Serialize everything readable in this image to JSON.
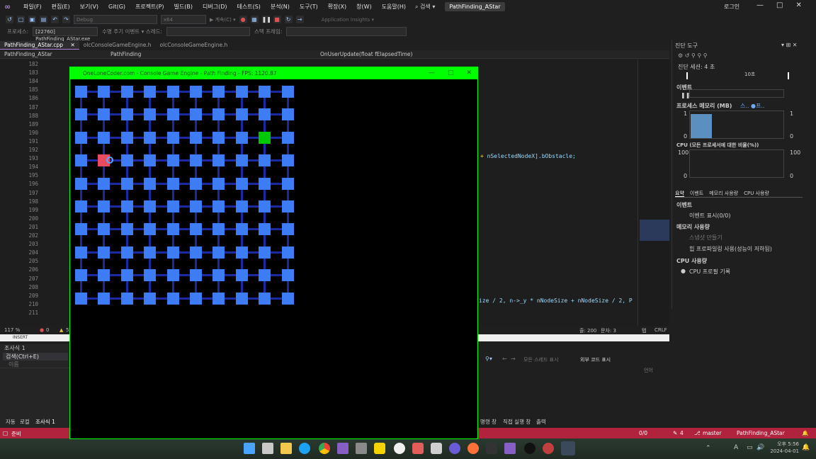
{
  "menubar": {
    "logo": "∞",
    "items": [
      "파일(F)",
      "편집(E)",
      "보기(V)",
      "Git(G)",
      "프로젝트(P)",
      "빌드(B)",
      "디버그(D)",
      "테스트(S)",
      "분석(N)",
      "도구(T)",
      "확장(X)",
      "창(W)",
      "도움말(H)"
    ],
    "search": "⌕ 검색 ▾",
    "solution_title": "PathFinding_AStar",
    "login": "로그인",
    "window_controls": [
      "—",
      "□",
      "✕"
    ]
  },
  "toolbar": {
    "config": "Debug",
    "platform": "x64",
    "continue_label": "▶ 계속(C) ▾",
    "insights": "Application Insights ▾",
    "process_label": "프로세스:",
    "process_value": "[22760] PathFinding_AStar.exe",
    "lifecycle": "수명 주기 이벤트 ▾ 스레드:",
    "stackframe": "스택 프레임:"
  },
  "tabs": [
    {
      "label": "PathFinding_AStar.cpp",
      "active": true,
      "suffix": "✕"
    },
    {
      "label": "olcConsoleGameEngine.h",
      "active": false
    },
    {
      "label": "olcConsoleGameEngine.h",
      "active": false
    }
  ],
  "navbar": {
    "project": "PathFinding_AStar",
    "scope": "PathFinding",
    "member": "OnUserUpdate(float fElapsedTime)"
  },
  "editor": {
    "line_numbers": [
      "182",
      "183",
      "184",
      "185",
      "186",
      "187",
      "188",
      "189",
      "190",
      "191",
      "192",
      "193",
      "194",
      "195",
      "196",
      "197",
      "198",
      "199",
      "200",
      "201",
      "202",
      "203",
      "204",
      "205",
      "206",
      "207",
      "208",
      "209",
      "210",
      "211"
    ],
    "code_line_1": "nSelectedNodeX].bObstacle;",
    "code_line_2": "ize / 2, n->_y * nNodeSize + nNodeSize / 2, P",
    "zoom": "117 %",
    "status_ln": "줄: 200",
    "status_col": "문자: 3",
    "status_space": "탭",
    "status_eol": "CRLF",
    "status_errors": "0",
    "status_warnings": "5"
  },
  "insert_mode": "INSERT",
  "watch": {
    "title": "조사식 1",
    "search": "검색(Ctrl+E)",
    "col_name": "이름",
    "col_lang": "언어"
  },
  "callstack_toolbar": {
    "show_threads": "모든 스레드 표시",
    "external_code": "외부 코드 표시"
  },
  "bottom_tabs": [
    "자동",
    "로컬",
    "조사식 1"
  ],
  "bottom_tabs_right": [
    "호출 스택",
    "중단점",
    "예외 설정",
    "명령 창",
    "직접 실행 창",
    "출력"
  ],
  "statusbar": {
    "ready": "준비",
    "lines": "0/0",
    "pencil_count": "4",
    "branch": "master",
    "repo": "PathFinding_AStar"
  },
  "diagnostics": {
    "title": "진단 도구",
    "session": "진단 세션: 4 초",
    "time_tick": "10초",
    "events": "이벤트",
    "memory": "프로세스 메모리 (MB)",
    "memory_legend": "스.. ●프..",
    "mem_max": "1",
    "mem_min": "0",
    "cpu": "CPU (모든 프로세서에 대한 비율(%))",
    "cpu_max": "100",
    "cpu_min": "0",
    "subtabs": [
      "요약",
      "이벤트",
      "메모리 사용량",
      "CPU 사용량"
    ],
    "sec_events": "이벤트",
    "show_events": "이벤트 표시(0/0)",
    "sec_memory": "메모리 사용량",
    "snapshot": "스냅샷 만들기",
    "heap": "힙 프로파일링 사용(성능이 저하됨)",
    "sec_cpu": "CPU 사용량",
    "cpu_record": "CPU 프로필 기록"
  },
  "console": {
    "title": "OneLoneCoder.com - Console Game Engine - Path Finding - FPS: 1120.87",
    "grid_cols": 10,
    "grid_rows": 10,
    "start_node": {
      "col": 1,
      "row": 3
    },
    "end_node": {
      "col": 8,
      "row": 2
    },
    "node_color": "#3d7cf5",
    "start_color": "#e84a5f",
    "end_color": "#00c800",
    "link_color": "#1a2aa0"
  },
  "taskbar": {
    "time": "오후 5:56",
    "date": "2024-04-01",
    "ime": "A"
  },
  "colors": {
    "status_bar": "#b1223c",
    "console_border": "#00ff00",
    "vs_accent": "#b180d7"
  }
}
